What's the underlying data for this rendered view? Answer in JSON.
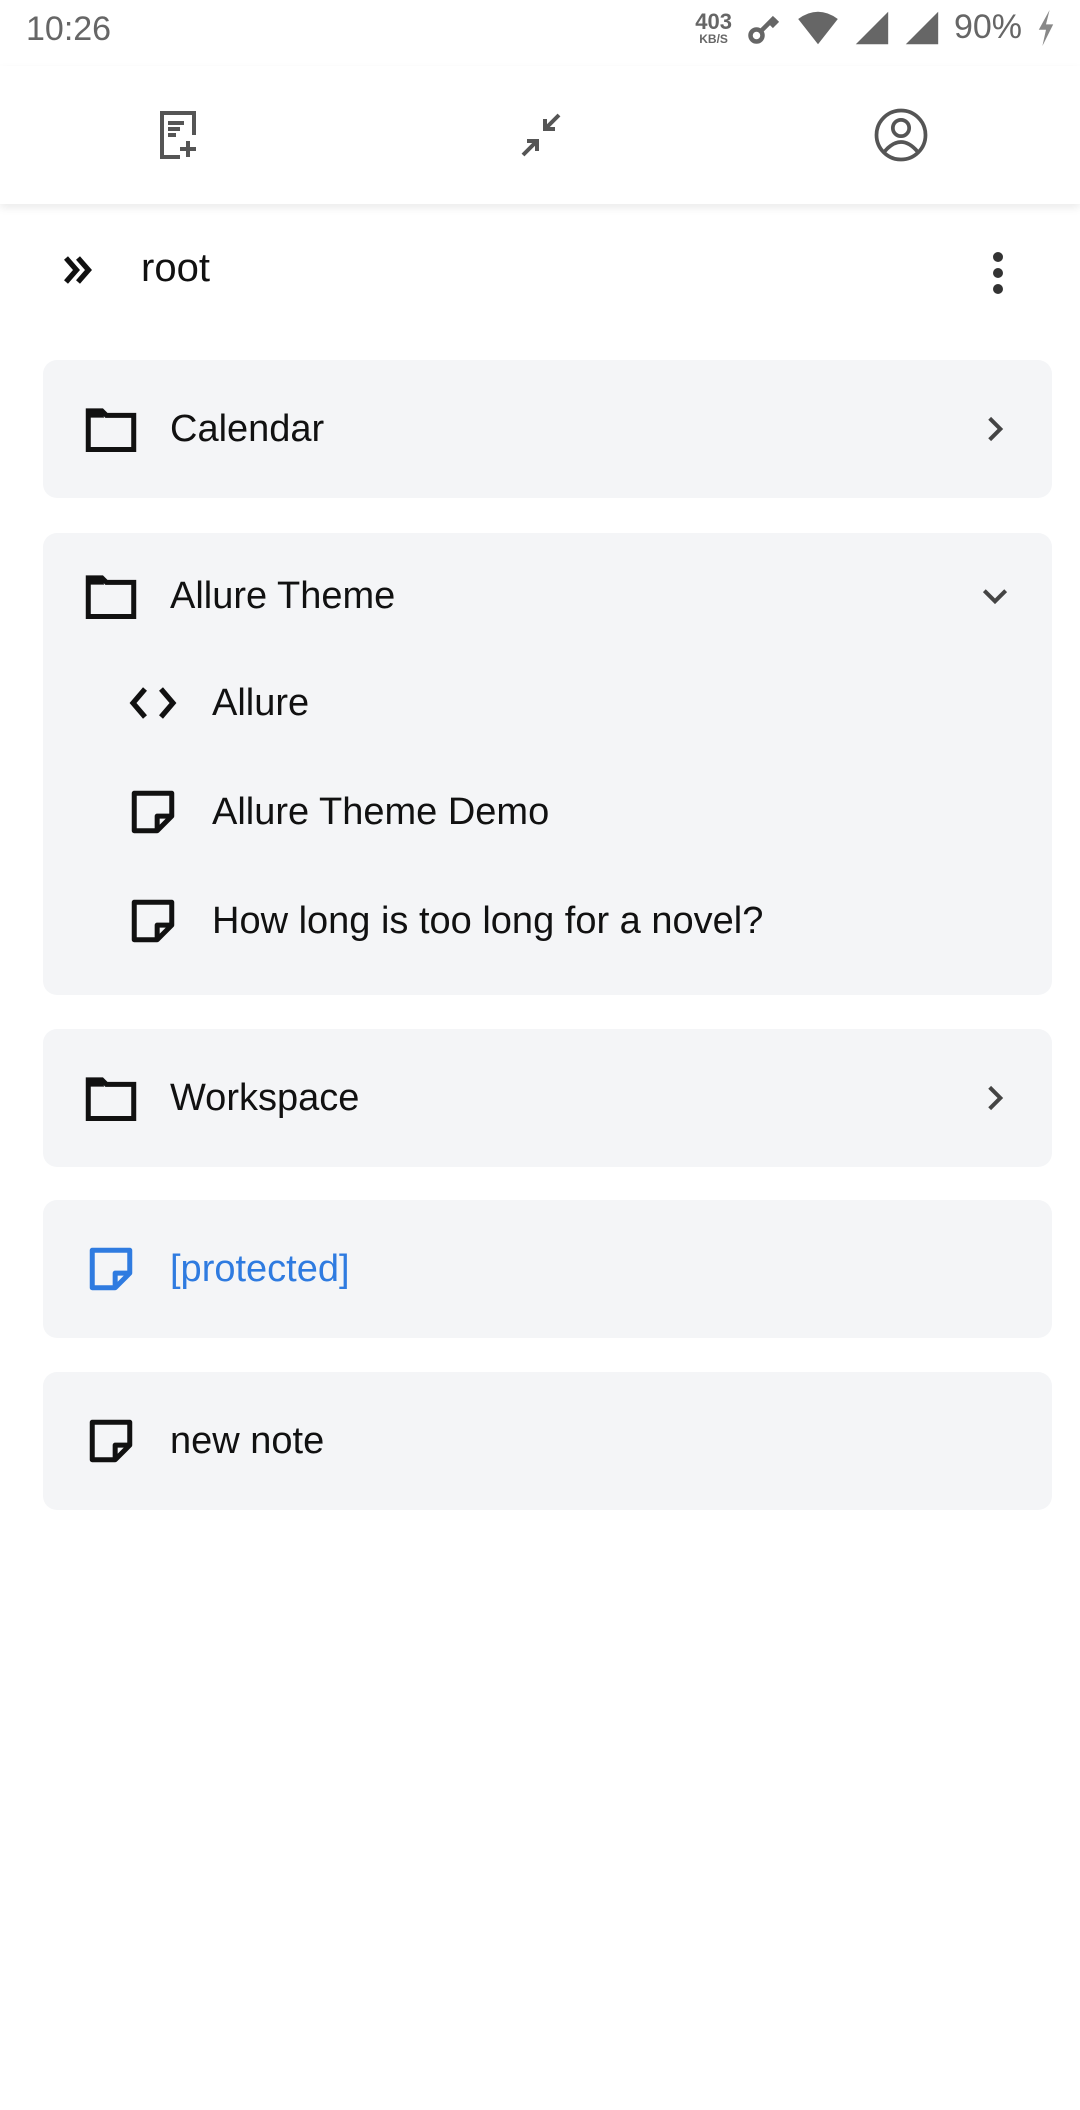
{
  "status_bar": {
    "time": "10:26",
    "net_speed": "403",
    "net_unit": "KB/S",
    "battery": "90%"
  },
  "toolbar": {
    "icons": [
      "new-note-icon",
      "collapse-icon",
      "account-icon"
    ]
  },
  "breadcrumb": {
    "label": "root"
  },
  "tree": [
    {
      "type": "folder",
      "label": "Calendar",
      "expanded": false
    },
    {
      "type": "folder",
      "label": "Allure Theme",
      "expanded": true,
      "children": [
        {
          "type": "code",
          "label": "Allure"
        },
        {
          "type": "note",
          "label": "Allure Theme Demo"
        },
        {
          "type": "note",
          "label": "How long is too long for a novel?"
        }
      ]
    },
    {
      "type": "folder",
      "label": "Workspace",
      "expanded": false
    },
    {
      "type": "note",
      "label": "[protected]",
      "color": "#2f7be0"
    },
    {
      "type": "note",
      "label": "new note"
    }
  ],
  "colors": {
    "card_bg": "#f4f5f7",
    "accent": "#2f7be0"
  }
}
